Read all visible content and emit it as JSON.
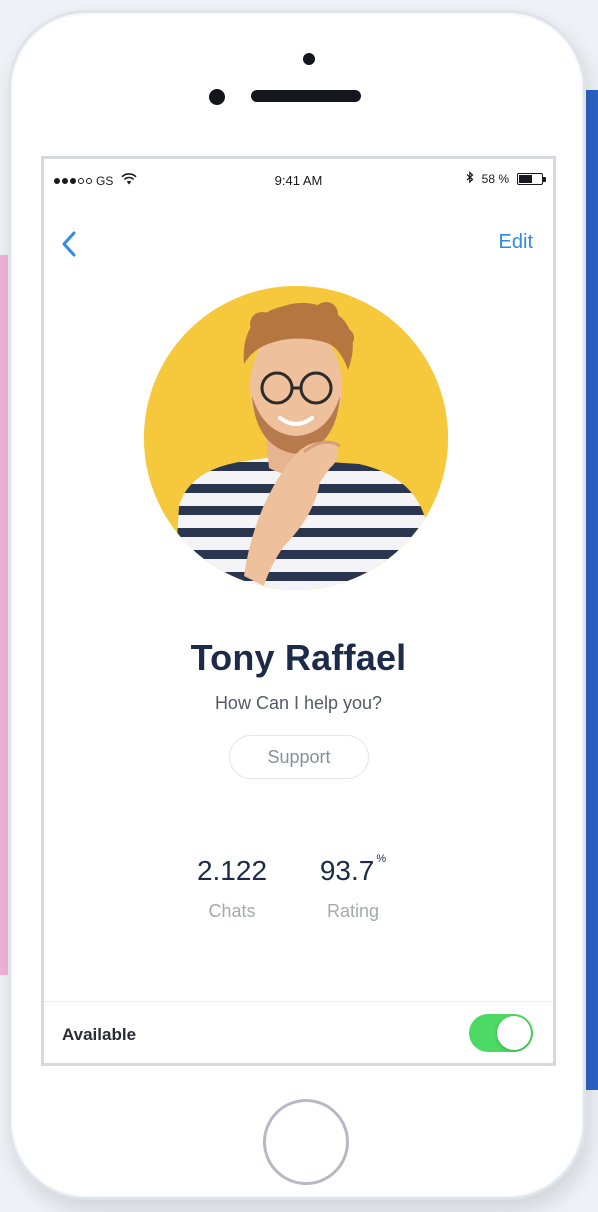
{
  "status_bar": {
    "carrier": "GS",
    "time": "9:41 AM",
    "battery_percent": "58 %",
    "battery_level": 0.58
  },
  "nav": {
    "back_icon": "chevron-left-icon",
    "edit_label": "Edit"
  },
  "profile": {
    "name": "Tony Raffael",
    "tagline": "How Can I help you?",
    "support_label": "Support",
    "avatar_background": "#f6c83c"
  },
  "stats": {
    "chats_value": "2.122",
    "chats_label": "Chats",
    "rating_value": "93.7",
    "rating_unit": "%",
    "rating_label": "Rating"
  },
  "availability": {
    "label": "Available",
    "enabled": true,
    "toggle_color": "#4cd964"
  },
  "colors": {
    "accent": "#2e8be6",
    "name_text": "#1c2b47"
  }
}
